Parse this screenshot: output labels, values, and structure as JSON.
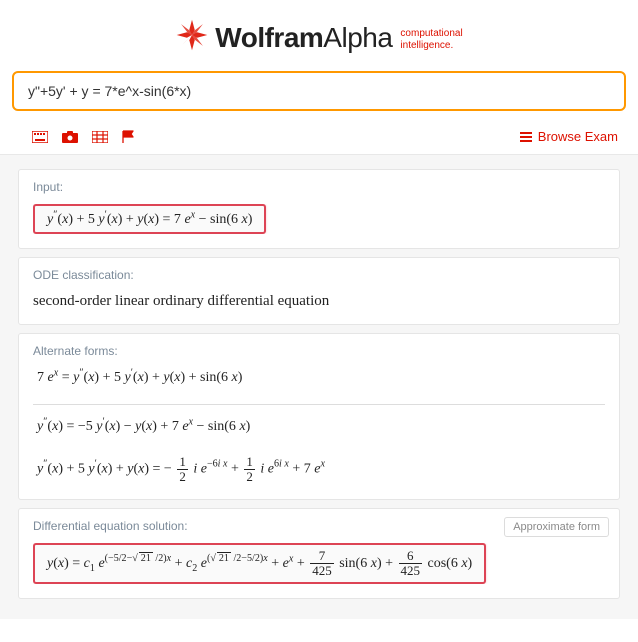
{
  "brand": {
    "bold": "Wolfram",
    "light": "Alpha",
    "tagline1": "computational",
    "tagline2": "intelligence."
  },
  "search": {
    "value": "y\"+5y' + y = 7*e^x-sin(6*x)"
  },
  "toolbar": {
    "browse_label": "Browse Exam"
  },
  "pods": {
    "input": {
      "title": "Input:"
    },
    "ode": {
      "title": "ODE classification:",
      "text": "second-order linear ordinary differential equation"
    },
    "alt": {
      "title": "Alternate forms:"
    },
    "solution": {
      "title": "Differential equation solution:",
      "approx_btn": "Approximate form"
    }
  }
}
